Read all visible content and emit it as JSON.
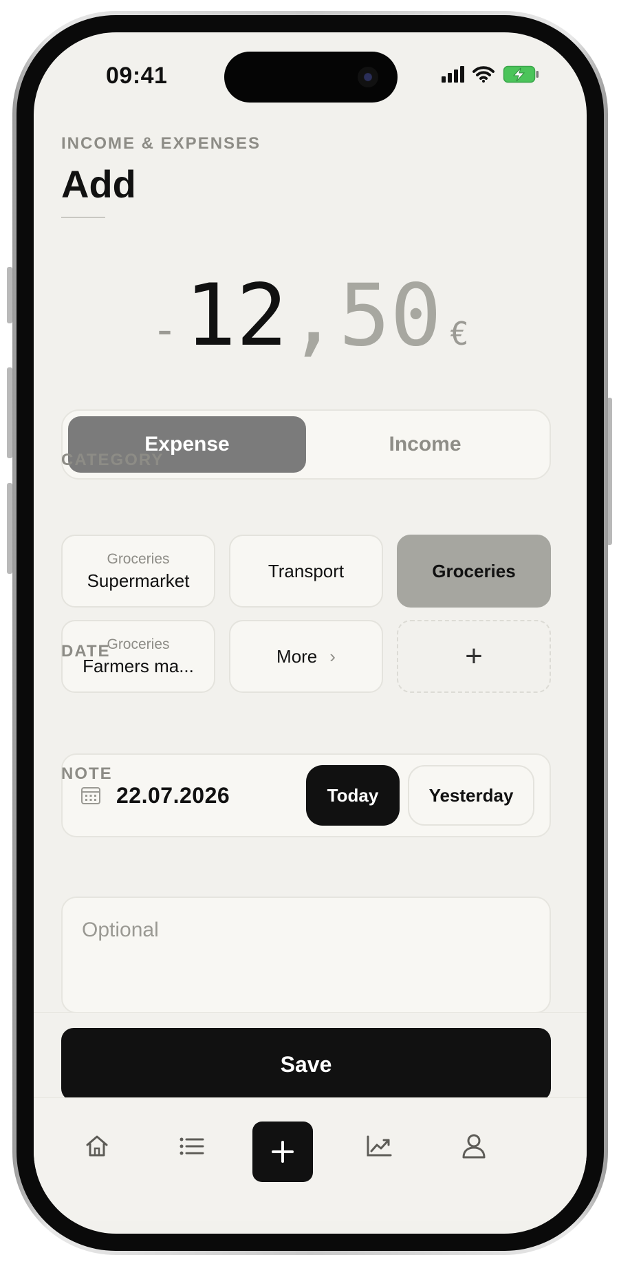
{
  "status_bar": {
    "time": "09:41"
  },
  "header": {
    "eyebrow": "INCOME & EXPENSES",
    "title": "Add"
  },
  "amount": {
    "sign": "-",
    "integer": "12",
    "separator": ",",
    "decimals": "50",
    "currency": "€"
  },
  "type_toggle": {
    "options": [
      "Expense",
      "Income"
    ],
    "selected": "Expense"
  },
  "category": {
    "label": "CATEGORY",
    "items": [
      {
        "sub": "Groceries",
        "label": "Supermarket",
        "selected": false
      },
      {
        "sub": "",
        "label": "Transport",
        "selected": false
      },
      {
        "sub": "",
        "label": "Groceries",
        "selected": true
      },
      {
        "sub": "Groceries",
        "label": "Farmers ma...",
        "selected": false
      },
      {
        "sub": "",
        "label": "More",
        "icon": "chevron-right-icon"
      },
      {
        "sub": "",
        "label": "+",
        "icon": "plus-icon"
      }
    ]
  },
  "date": {
    "label": "DATE",
    "value": "22.07.2026",
    "today_label": "Today",
    "yesterday_label": "Yesterday",
    "icon": "calendar-icon"
  },
  "note": {
    "label": "NOTE",
    "placeholder": "Optional",
    "value": ""
  },
  "save_label": "Save",
  "tabbar": {
    "items": [
      "home-icon",
      "list-icon",
      "plus-icon",
      "chart-icon",
      "user-icon"
    ],
    "active": "plus-icon"
  },
  "colors": {
    "background": "#f2f1ed",
    "selected_toggle": "#7b7b7b",
    "selected_category": "#a6a6a0",
    "primary": "#111111"
  }
}
